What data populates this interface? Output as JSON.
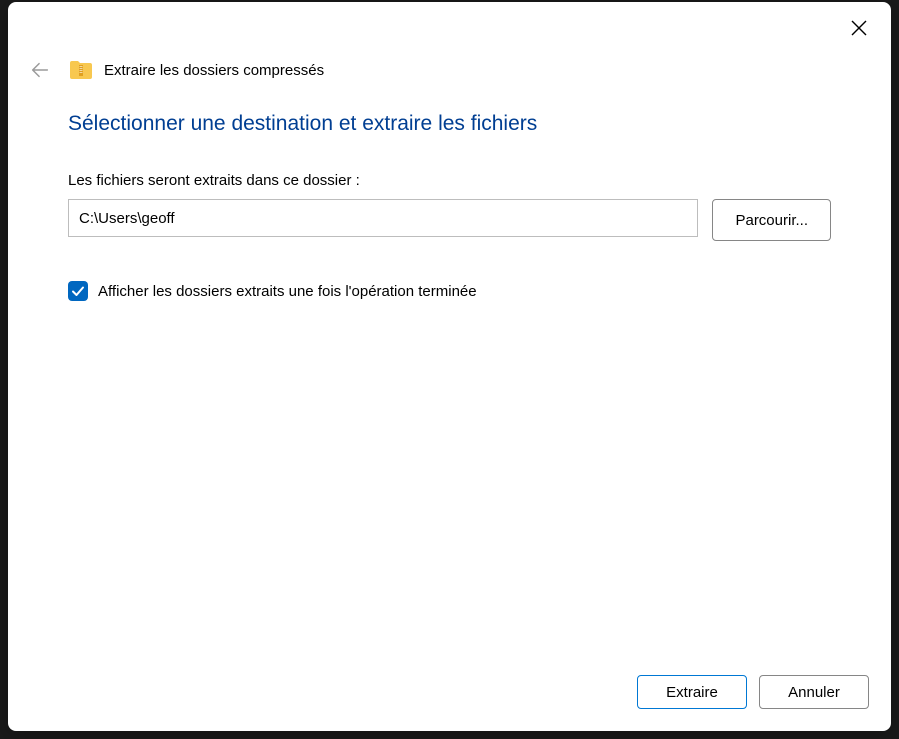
{
  "header": {
    "title": "Extraire les dossiers compressés"
  },
  "main": {
    "heading": "Sélectionner une destination et extraire les fichiers",
    "instruction": "Les fichiers seront extraits dans ce dossier :",
    "path_value": "C:\\Users\\geoff",
    "browse_label": "Parcourir...",
    "checkbox_label": "Afficher les dossiers extraits une fois l'opération terminée",
    "checkbox_checked": true
  },
  "footer": {
    "extract_label": "Extraire",
    "cancel_label": "Annuler"
  }
}
